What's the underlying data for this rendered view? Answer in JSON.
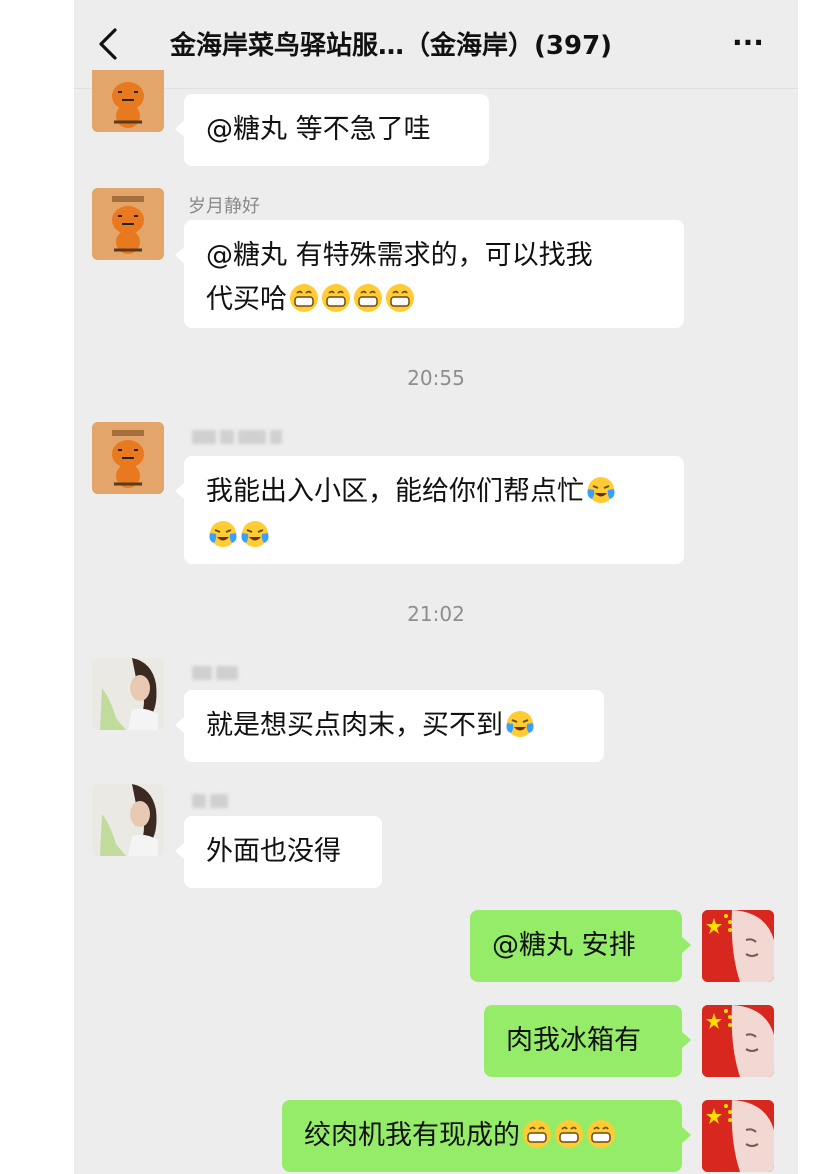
{
  "header": {
    "title": "金海岸菜鸟驿站服…（金海岸）(397)",
    "back_icon": "chevron-left-icon",
    "more_icon": "more-dots-icon",
    "more_label": "···"
  },
  "messages": [
    {
      "type": "in",
      "avatar": "tiger-avatar",
      "sender": "",
      "text": "@糖丸  等不急了哇",
      "emojis": ""
    },
    {
      "type": "in",
      "avatar": "tiger-avatar",
      "sender": "岁月静好",
      "text": "@糖丸  有特殊需求的，可以找我",
      "text2": "代买哈",
      "emojis": "grinning x4"
    },
    {
      "type": "time",
      "text": "20:55"
    },
    {
      "type": "in",
      "avatar": "tiger-avatar",
      "sender": "blurred",
      "text": "我能出入小区，能给你们帮点忙",
      "emojis": "crying-laughing x3"
    },
    {
      "type": "time",
      "text": "21:02"
    },
    {
      "type": "in",
      "avatar": "girl-avatar",
      "sender": "blurred",
      "text": "就是想买点肉末，买不到",
      "emojis": "crying-laughing x1"
    },
    {
      "type": "in",
      "avatar": "girl-avatar",
      "sender": "blurred",
      "text": "外面也没得",
      "emojis": ""
    },
    {
      "type": "out",
      "avatar": "flag-avatar",
      "text": "@糖丸  安排"
    },
    {
      "type": "out",
      "avatar": "flag-avatar",
      "text": "肉我冰箱有"
    },
    {
      "type": "out",
      "avatar": "flag-avatar",
      "text": "绞肉机我有现成的",
      "emojis": "grinning x3"
    }
  ],
  "colors": {
    "screen_bg": "#ededed",
    "incoming_bubble": "#ffffff",
    "outgoing_bubble": "#95ec69",
    "time_text": "#8e8e8e",
    "name_text": "#8a8a8a"
  }
}
